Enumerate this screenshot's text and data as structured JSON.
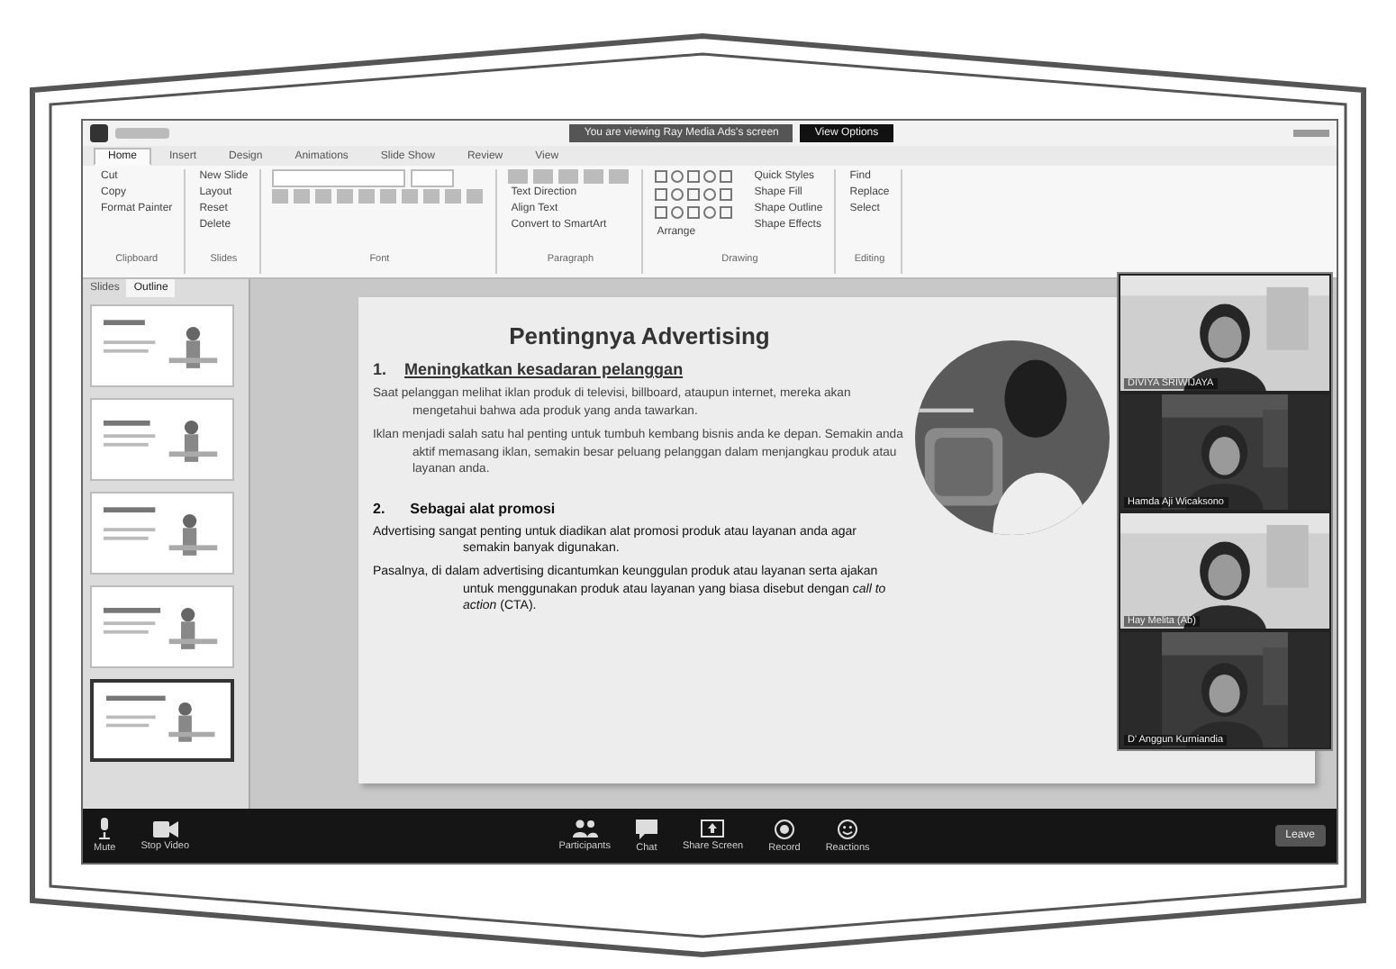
{
  "window": {
    "title": "You are viewing Ray Media Ads's screen",
    "view_options": "View Options"
  },
  "ribbon": {
    "tabs": [
      {
        "label": "Home",
        "selected": true
      },
      {
        "label": "Insert",
        "selected": false
      },
      {
        "label": "Design",
        "selected": false
      },
      {
        "label": "Animations",
        "selected": false
      },
      {
        "label": "Slide Show",
        "selected": false
      },
      {
        "label": "Review",
        "selected": false
      },
      {
        "label": "View",
        "selected": false
      }
    ],
    "groups": [
      {
        "label": "Clipboard",
        "kind": "commands",
        "commands": [
          "Cut",
          "Copy",
          "Format Painter"
        ]
      },
      {
        "label": "Slides",
        "kind": "commands",
        "commands": [
          "New Slide",
          "Layout",
          "Reset",
          "Delete"
        ]
      },
      {
        "label": "Font",
        "kind": "font"
      },
      {
        "label": "Paragraph",
        "kind": "paragraph",
        "commands": [
          "Text Direction",
          "Align Text",
          "Convert to SmartArt"
        ]
      },
      {
        "label": "Drawing",
        "kind": "drawing",
        "commands": [
          "Arrange",
          "Quick Styles",
          "Shape Fill",
          "Shape Outline",
          "Shape Effects"
        ]
      },
      {
        "label": "Editing",
        "kind": "commands",
        "commands": [
          "Find",
          "Replace",
          "Select"
        ]
      }
    ]
  },
  "sidebar": {
    "tabs": [
      {
        "label": "Slides",
        "selected": false
      },
      {
        "label": "Outline",
        "selected": true
      }
    ],
    "thumbnails": [
      {
        "selected": false
      },
      {
        "selected": false
      },
      {
        "selected": false
      },
      {
        "selected": false
      },
      {
        "selected": true
      }
    ]
  },
  "slide": {
    "title": "Pentingnya Advertising",
    "blocks": [
      {
        "kind": "heading",
        "number": "1.",
        "text": "Meningkatkan kesadaran pelanggan"
      },
      {
        "kind": "body",
        "text": "Saat pelanggan melihat iklan produk di televisi, billboard, ataupun internet, mereka akan mengetahui bahwa ada produk yang anda tawarkan."
      },
      {
        "kind": "body",
        "text": "Iklan menjadi salah satu hal penting untuk tumbuh kembang bisnis anda ke depan. Semakin anda aktif memasang iklan, semakin besar peluang pelanggan dalam menjangkau produk atau layanan anda."
      },
      {
        "kind": "heading2",
        "number": "2.",
        "text": "Sebagai alat promosi"
      },
      {
        "kind": "body2",
        "text": "Advertising sangat penting untuk diadikan alat promosi produk atau layanan anda agar semakin banyak digunakan."
      },
      {
        "kind": "body2",
        "text": "Pasalnya, di dalam advertising dicantumkan keunggulan produk atau layanan serta ajakan untuk menggunakan produk atau layanan yang biasa disebut dengan *call to action* (CTA)."
      }
    ]
  },
  "video_tiles": [
    {
      "kind": "wide",
      "name": "DIVIYA SRIWIJAYA"
    },
    {
      "kind": "narrow",
      "name": "Hamda Aji Wicaksono"
    },
    {
      "kind": "wide",
      "name": "Hay Melita (Ab)"
    },
    {
      "kind": "narrow",
      "name": "D' Anggun Kurniandia"
    }
  ],
  "toolbar": {
    "left": [
      {
        "kind": "mic",
        "label": "Mute"
      },
      {
        "kind": "camera",
        "label": "Stop Video"
      }
    ],
    "center": [
      {
        "kind": "people",
        "label": "Participants"
      },
      {
        "kind": "chat",
        "label": "Chat"
      },
      {
        "kind": "share",
        "label": "Share Screen"
      },
      {
        "kind": "record",
        "label": "Record"
      },
      {
        "kind": "reactions",
        "label": "Reactions"
      }
    ],
    "leave": "Leave"
  }
}
